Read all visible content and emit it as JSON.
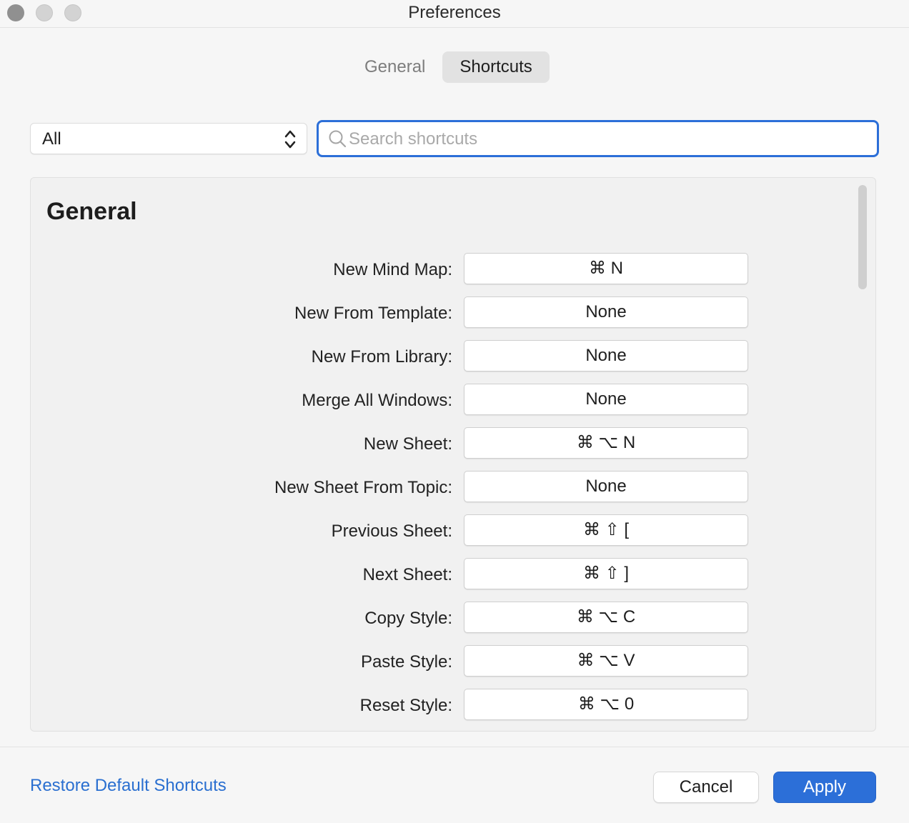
{
  "window": {
    "title": "Preferences"
  },
  "tabs": [
    {
      "label": "General",
      "active": false
    },
    {
      "label": "Shortcuts",
      "active": true
    }
  ],
  "filter": {
    "selected": "All"
  },
  "search": {
    "placeholder": "Search shortcuts",
    "value": ""
  },
  "section": {
    "title": "General",
    "rows": [
      {
        "label": "New Mind Map:",
        "shortcut": "⌘ N"
      },
      {
        "label": "New From Template:",
        "shortcut": "None"
      },
      {
        "label": "New From Library:",
        "shortcut": "None"
      },
      {
        "label": "Merge All Windows:",
        "shortcut": "None"
      },
      {
        "label": "New Sheet:",
        "shortcut": "⌘ ⌥ N"
      },
      {
        "label": "New Sheet From Topic:",
        "shortcut": "None"
      },
      {
        "label": "Previous Sheet:",
        "shortcut": "⌘ ⇧ ["
      },
      {
        "label": "Next Sheet:",
        "shortcut": "⌘ ⇧ ]"
      },
      {
        "label": "Copy Style:",
        "shortcut": "⌘ ⌥ C"
      },
      {
        "label": "Paste Style:",
        "shortcut": "⌘ ⌥ V"
      },
      {
        "label": "Reset Style:",
        "shortcut": "⌘ ⌥ 0"
      }
    ]
  },
  "footer": {
    "restore_label": "Restore Default Shortcuts",
    "cancel_label": "Cancel",
    "apply_label": "Apply"
  },
  "colors": {
    "accent": "#2c6fd8",
    "link": "#2a6fd0"
  }
}
